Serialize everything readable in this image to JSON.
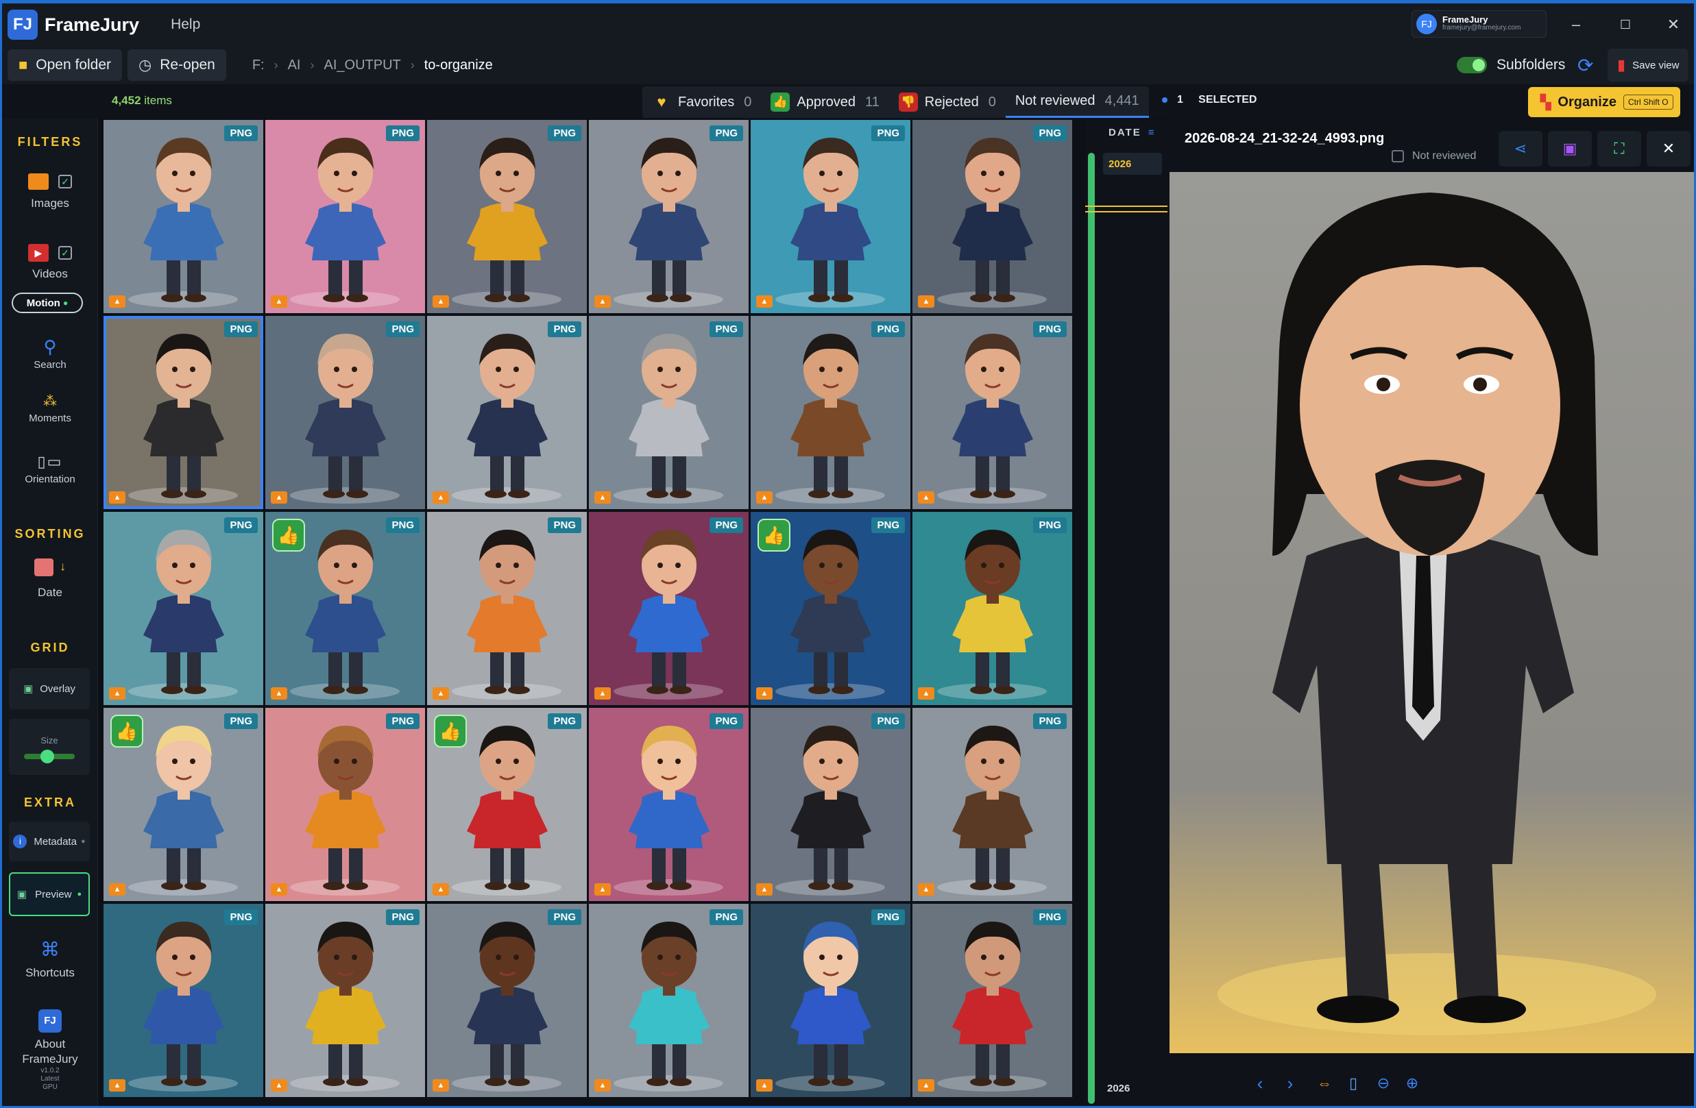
{
  "app": {
    "name": "FrameJury",
    "logo": "FJ",
    "menu_help": "Help"
  },
  "account": {
    "name": "FrameJury",
    "email": "framejury@framejury.com"
  },
  "window_controls": {
    "minimize": "–",
    "maximize": "☐",
    "close": "✕"
  },
  "toolbar": {
    "open_folder": "Open folder",
    "reopen": "Re-open",
    "breadcrumbs": [
      "F:",
      "AI",
      "AI_OUTPUT",
      "to-organize"
    ],
    "subfolders": "Subfolders",
    "save_view": "Save view"
  },
  "status": {
    "items_count": "4,452",
    "items_label": "items",
    "tabs": [
      {
        "label": "Favorites",
        "count": "0",
        "icon": "heart-icon"
      },
      {
        "label": "Approved",
        "count": "11",
        "icon": "thumbs-up-icon"
      },
      {
        "label": "Rejected",
        "count": "0",
        "icon": "thumbs-down-icon"
      },
      {
        "label": "Not reviewed",
        "count": "4,441",
        "icon": ""
      }
    ],
    "selected_count": "1",
    "selected_label": "SELECTED",
    "organize": "Organize",
    "organize_shortcut": "Ctrl Shift O"
  },
  "sidebar": {
    "filters_heading": "FILTERS",
    "images": "Images",
    "videos": "Videos",
    "motion": "Motion",
    "search": "Search",
    "moments": "Moments",
    "orientation": "Orientation",
    "sorting_heading": "SORTING",
    "date": "Date",
    "grid_heading": "GRID",
    "overlay": "Overlay",
    "size": "Size",
    "size_value": 0.45,
    "extra_heading": "EXTRA",
    "metadata": "Metadata",
    "preview": "Preview",
    "shortcuts": "Shortcuts",
    "about": "About",
    "about_app": "FrameJury",
    "version": "v1.0.2",
    "channel": "Latest",
    "gpu": "GPU"
  },
  "grid": {
    "badge": "PNG",
    "tiles": [
      {
        "bg": "#7c8894",
        "suit": "#3b6fb5",
        "hair": "#5a3a22",
        "skin": "#e8b89a",
        "approved": false
      },
      {
        "bg": "#d98aa8",
        "suit": "#3d66b8",
        "hair": "#4a2e1c",
        "skin": "#e6b294",
        "approved": false
      },
      {
        "bg": "#6d7380",
        "suit": "#e0a020",
        "hair": "#2a1e18",
        "skin": "#dca888",
        "approved": false
      },
      {
        "bg": "#8a9099",
        "suit": "#2f4574",
        "hair": "#2a1e18",
        "skin": "#e2b090",
        "approved": false
      },
      {
        "bg": "#3e9ab5",
        "suit": "#2f4a84",
        "hair": "#3a2a20",
        "skin": "#e2b090",
        "approved": false
      },
      {
        "bg": "#5a6470",
        "suit": "#1f2c4a",
        "hair": "#4a3224",
        "skin": "#e0a888",
        "approved": false
      },
      {
        "bg": "#7a7468",
        "suit": "#2b2b2e",
        "hair": "#1a1614",
        "skin": "#e2b494",
        "approved": false
      },
      {
        "bg": "#5f6e7c",
        "suit": "#2f3b58",
        "hair": "#c7a88e",
        "skin": "#e2b090",
        "approved": false
      },
      {
        "bg": "#9aa2aa",
        "suit": "#26324f",
        "hair": "#2a1e18",
        "skin": "#e2b090",
        "approved": false
      },
      {
        "bg": "#7c8994",
        "suit": "#b8bcc2",
        "hair": "#9a9a9a",
        "skin": "#e0b090",
        "approved": false
      },
      {
        "bg": "#758391",
        "suit": "#7a4a28",
        "hair": "#1e1a18",
        "skin": "#d9a07a",
        "approved": false
      },
      {
        "bg": "#7b8590",
        "suit": "#2a3f70",
        "hair": "#4a3224",
        "skin": "#e2ac8a",
        "approved": false
      },
      {
        "bg": "#5e9aa5",
        "suit": "#2a3a6a",
        "hair": "#a8a8a8",
        "skin": "#e0ac8c",
        "approved": false
      },
      {
        "bg": "#4f7d8e",
        "suit": "#2d4f8e",
        "hair": "#4a3020",
        "skin": "#dca484",
        "approved": true
      },
      {
        "bg": "#a5a9ae",
        "suit": "#e47a2c",
        "hair": "#1c1614",
        "skin": "#d49a7c",
        "approved": false
      },
      {
        "bg": "#7a3558",
        "suit": "#2f6ad0",
        "hair": "#6a4226",
        "skin": "#e8b494",
        "approved": false
      },
      {
        "bg": "#1e4f86",
        "suit": "#2f3a55",
        "hair": "#1a1614",
        "skin": "#7a4a2e",
        "approved": true
      },
      {
        "bg": "#2f8a92",
        "suit": "#e6c43a",
        "hair": "#1a1614",
        "skin": "#6a3c24",
        "approved": false
      },
      {
        "bg": "#8b95a0",
        "suit": "#3a6aa8",
        "hair": "#f0d48a",
        "skin": "#f0c4a6",
        "approved": true
      },
      {
        "bg": "#d88c92",
        "suit": "#e58a20",
        "hair": "#a86a34",
        "skin": "#8a5434",
        "approved": false
      },
      {
        "bg": "#a6aaae",
        "suit": "#c8262a",
        "hair": "#1a1614",
        "skin": "#dca484",
        "approved": true
      },
      {
        "bg": "#b05a7c",
        "suit": "#2f68c8",
        "hair": "#e2b050",
        "skin": "#f0c09a",
        "approved": false
      },
      {
        "bg": "#6b7480",
        "suit": "#1e1e22",
        "hair": "#2a1e18",
        "skin": "#e2ac8a",
        "approved": false
      },
      {
        "bg": "#8d959e",
        "suit": "#5a3a24",
        "hair": "#1e1814",
        "skin": "#d8a07e",
        "approved": false
      },
      {
        "bg": "#2f6a80",
        "suit": "#2f58a8",
        "hair": "#3a2a20",
        "skin": "#dca484",
        "approved": false
      },
      {
        "bg": "#9ba1a8",
        "suit": "#e0b020",
        "hair": "#1a1614",
        "skin": "#6a3e26",
        "approved": false
      },
      {
        "bg": "#7b8590",
        "suit": "#283454",
        "hair": "#1a1614",
        "skin": "#5e3620",
        "approved": false
      },
      {
        "bg": "#8a929b",
        "suit": "#3ac0c8",
        "hair": "#1a1614",
        "skin": "#6a4028",
        "approved": false
      },
      {
        "bg": "#2e4a5e",
        "suit": "#2f58c8",
        "hair": "#3060b0",
        "skin": "#f0c8a8",
        "approved": false
      },
      {
        "bg": "#6a747e",
        "suit": "#c8262a",
        "hair": "#1a1614",
        "skin": "#d09a7a",
        "approved": false
      }
    ]
  },
  "timeline": {
    "heading": "DATE",
    "year_top": "2026",
    "year_bottom": "2026"
  },
  "preview": {
    "filename": "2026-08-24_21-32-24_4993.png",
    "status": "Not reviewed",
    "colors": {
      "bg_top": "#9a9a96",
      "bg_bottom": "#e8c060",
      "suit": "#26262a",
      "hair": "#141210",
      "skin": "#e6b48e"
    }
  }
}
